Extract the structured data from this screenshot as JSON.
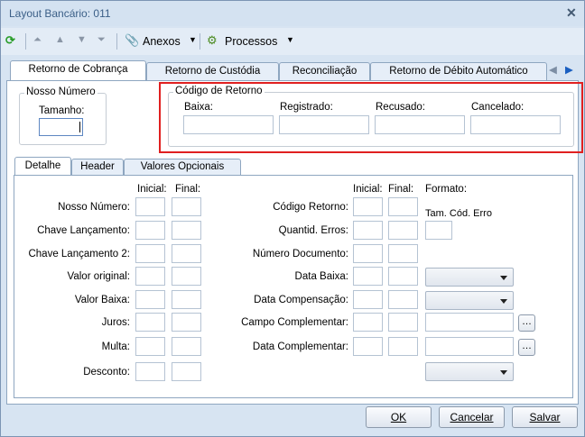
{
  "window": {
    "title": "Layout Bancário: 011"
  },
  "toolbar": {
    "anexos": "Anexos",
    "processos": "Processos"
  },
  "tabs": [
    "Retorno de Cobrança",
    "Retorno de Custódia",
    "Reconciliação",
    "Retorno de Débito Automático"
  ],
  "nosso": {
    "title": "Nosso Número",
    "tamanho": "Tamanho:"
  },
  "codigo": {
    "title": "Código de Retorno",
    "baixa": "Baixa:",
    "registrado": "Registrado:",
    "recusado": "Recusado:",
    "cancelado": "Cancelado:"
  },
  "subtabs": [
    "Detalhe",
    "Header",
    "Valores Opcionais"
  ],
  "left": {
    "inicial": "Inicial:",
    "final": "Final:",
    "rows": [
      "Nosso Número:",
      "Chave Lançamento:",
      "Chave Lançamento 2:",
      "Valor original:",
      "Valor Baixa:",
      "Juros:",
      "Multa:",
      "Desconto:"
    ]
  },
  "right": {
    "inicial": "Inicial:",
    "final": "Final:",
    "formato": "Formato:",
    "tam": "Tam. Cód. Erro",
    "rows": [
      "Código Retorno:",
      "Quantid. Erros:",
      "Número Documento:",
      "Data Baixa:",
      "Data Compensação:",
      "Campo Complementar:",
      "Data Complementar:"
    ]
  },
  "buttons": {
    "ok": "OK",
    "cancelar": "Cancelar",
    "salvar": "Salvar"
  },
  "colors": {
    "highlight": "#e02020"
  }
}
